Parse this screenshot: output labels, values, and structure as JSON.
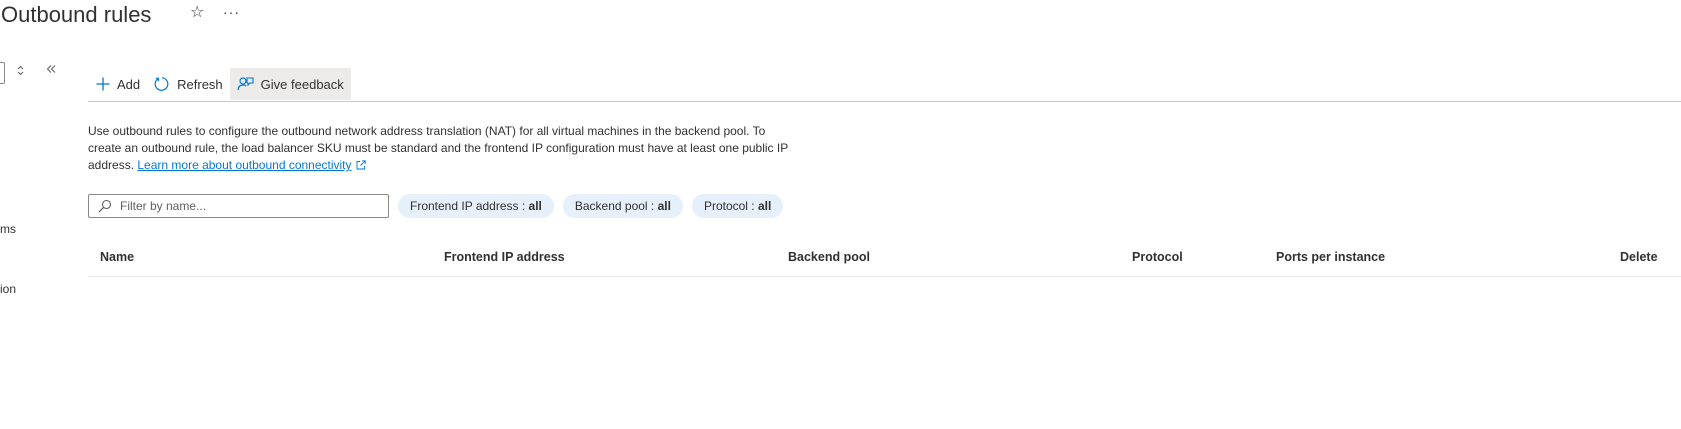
{
  "header": {
    "title": "Outbound rules",
    "favorite_icon": "star-icon",
    "more_icon": "more-icon",
    "more_glyph": "···"
  },
  "sidebar": {
    "collapse_icon": "double-chevron-left-icon",
    "sort_icon": "up-down-icon",
    "fragments": [
      "ms",
      "ion"
    ]
  },
  "toolbar": {
    "add_label": "Add",
    "refresh_label": "Refresh",
    "feedback_label": "Give feedback"
  },
  "description": {
    "text": "Use outbound rules to configure the outbound network address translation (NAT) for all virtual machines in the backend pool. To create an outbound rule, the load balancer SKU must be standard and the frontend IP configuration must have at least one public IP address.",
    "link_text": "Learn more about outbound connectivity"
  },
  "filters": {
    "search_placeholder": "Filter by name...",
    "pills": [
      {
        "label": "Frontend IP address : ",
        "value": "all"
      },
      {
        "label": "Backend pool : ",
        "value": "all"
      },
      {
        "label": "Protocol : ",
        "value": "all"
      }
    ]
  },
  "table": {
    "columns": [
      "Name",
      "Frontend IP address",
      "Backend pool",
      "Protocol",
      "Ports per instance",
      "Delete"
    ],
    "rows": []
  },
  "colors": {
    "accent": "#0078d4",
    "pill_bg": "#e5f0fb",
    "text": "#323130"
  }
}
